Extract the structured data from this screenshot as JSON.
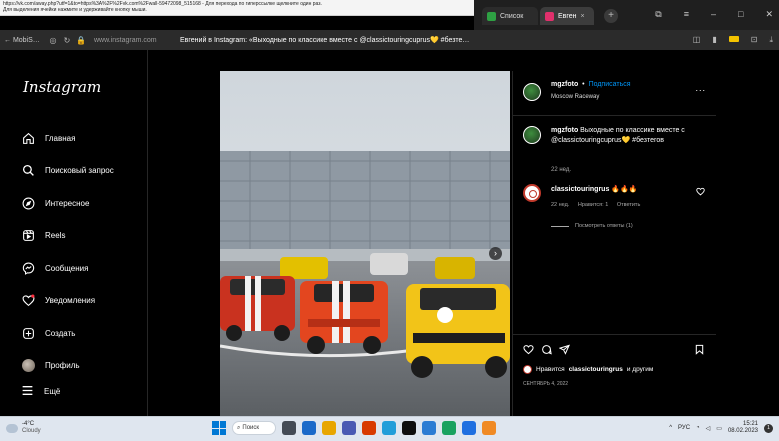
{
  "tooltip": {
    "line1": "https://vk.com/away.php?utf=1&to=https%3A%2F%2Fvk.com%2Fwall-59472098_515168 - Для перехода по гиперссылке щелкните один раз.",
    "line2": "Для выделения ячейки нажмите и удерживайте кнопку мыши."
  },
  "tabs": [
    {
      "label": "Список",
      "fav_color": "#2ea043"
    },
    {
      "label": "Евген",
      "fav_color": "#e1306c",
      "close": "×"
    }
  ],
  "new_tab": "+",
  "window_buttons": [
    "⧉",
    "≡",
    "–",
    "□",
    "✕"
  ],
  "address": {
    "back": "← MobiS…",
    "url": "www.instagram.com",
    "page_title": "Евгений в Instagram: «Выходные по классике вместе с @classictouringcuprus💛 #безте…"
  },
  "sidebar": {
    "logo": "Instagram",
    "items": [
      {
        "label": "Главная",
        "icon": "home-icon"
      },
      {
        "label": "Поисковый запрос",
        "icon": "search-icon"
      },
      {
        "label": "Интересное",
        "icon": "compass-icon"
      },
      {
        "label": "Reels",
        "icon": "reels-icon"
      },
      {
        "label": "Сообщения",
        "icon": "messenger-icon"
      },
      {
        "label": "Уведомления",
        "icon": "heart-icon"
      },
      {
        "label": "Создать",
        "icon": "create-icon"
      },
      {
        "label": "Профиль",
        "icon": "profile-avatar"
      }
    ],
    "more": "Ещё"
  },
  "post": {
    "username": "mgzfoto",
    "dot": "•",
    "follow": "Подписаться",
    "location": "Moscow Raceway",
    "more": "...",
    "caption_user": "mgzfoto",
    "caption_text": "Выходные по классике вместе с @classictouringcuprus💛 #безтегов",
    "caption_time": "22 нед.",
    "comment": {
      "user": "classictouringrus",
      "emoji": "🔥🔥🔥",
      "time": "22 нед.",
      "likes": "Нравится: 1",
      "reply": "Ответить",
      "view_replies": "Посмотреть ответы (1)"
    },
    "likes_prefix": "Нравится",
    "likes_user": "classictouringrus",
    "likes_suffix": "и другим",
    "date": "СЕНТЯБРЬ 4, 2022"
  },
  "taskbar": {
    "temp": "-4°C",
    "weather": "Cloudy",
    "search": "Поиск",
    "lang": "РУС",
    "time": "15:21",
    "date": "08.02.2023",
    "notif": "1",
    "apps": [
      "#444b55",
      "#e8a600",
      "#1b6ac9",
      "#4a5ab3",
      "#d83b01",
      "#229ed9",
      "#0f0f0f",
      "#2b7cd3",
      "#1aa260",
      "#1f6fe0",
      "#f08a24"
    ]
  },
  "colors": {
    "accent": "#0095f6",
    "taskbar": "#dfe6ef"
  }
}
